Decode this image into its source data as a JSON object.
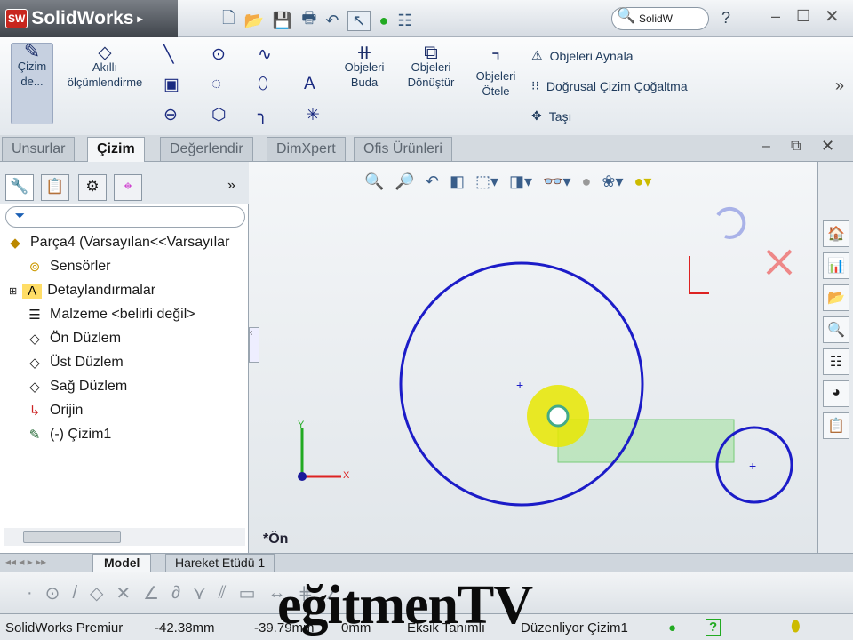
{
  "app": {
    "title": "SolidWorks",
    "badge": "SW"
  },
  "toolbar": {
    "search_placeholder": "SolidW",
    "help": "?"
  },
  "ribbon": {
    "sketch": "Çizim de...",
    "smart_dim": "Akıllı ölçümlendirme",
    "trim": "Objeleri Buda",
    "convert": "Objeleri Dönüştür",
    "offset": "Objeleri Ötele",
    "mirror": "Objeleri Aynala",
    "linear_pattern": "Doğrusal Çizim Çoğaltma",
    "move": "Taşı"
  },
  "tabs": [
    "Unsurlar",
    "Çizim",
    "Değerlendir",
    "DimXpert",
    "Ofis Ürünleri"
  ],
  "filter_icon": "funnel-icon",
  "tree": [
    {
      "label": "Parça4  (Varsayılan<<Varsayılar",
      "icon": "part-icon"
    },
    {
      "label": "Sensörler",
      "icon": "sensor-icon"
    },
    {
      "label": "Detaylandırmalar",
      "icon": "annotation-icon"
    },
    {
      "label": "Malzeme <belirli değil>",
      "icon": "material-icon"
    },
    {
      "label": "Ön Düzlem",
      "icon": "plane-icon"
    },
    {
      "label": "Üst Düzlem",
      "icon": "plane-icon"
    },
    {
      "label": "Sağ Düzlem",
      "icon": "plane-icon"
    },
    {
      "label": "Orijin",
      "icon": "origin-icon"
    },
    {
      "label": "(-) Çizim1",
      "icon": "sketch-icon"
    }
  ],
  "viewport": {
    "view_label": "*Ön",
    "axis_x": "X",
    "axis_y": "Y"
  },
  "bottom_tabs": [
    "Model",
    "Hareket Etüdü 1"
  ],
  "status": {
    "product": "SolidWorks Premiur",
    "x": "-42.38mm",
    "y": "-39.79mm",
    "z": "0mm",
    "state": "Eksik Tanımlı",
    "mode": "Düzenliyor Çizim1"
  },
  "watermark": "eğitmenTV",
  "colors": {
    "sketch": "#1c1cc8",
    "highlight": "#e8e800",
    "accent": "#c8261e"
  }
}
